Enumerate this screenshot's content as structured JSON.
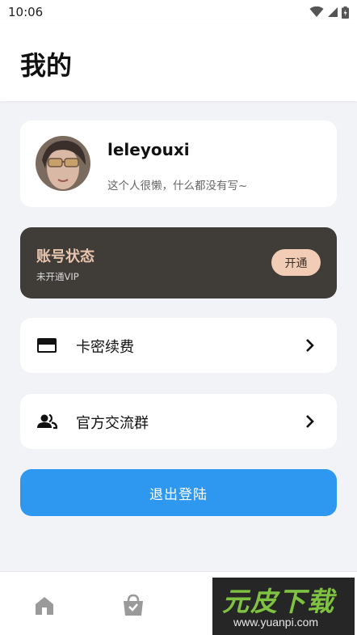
{
  "status_bar": {
    "time": "10:06",
    "icons": [
      "wifi-icon",
      "signal-icon",
      "battery-charging-icon"
    ]
  },
  "header": {
    "title": "我的"
  },
  "profile": {
    "username": "leleyouxi",
    "bio": "这个人很懒，什么都没有写~"
  },
  "account": {
    "title": "账号状态",
    "status": "未开通VIP",
    "button": "开通"
  },
  "menu": [
    {
      "label": "卡密续费",
      "icon": "credit-card-icon"
    },
    {
      "label": "官方交流群",
      "icon": "group-icon"
    }
  ],
  "logout": {
    "label": "退出登陆"
  },
  "bottom_nav": [
    {
      "icon": "home-icon"
    },
    {
      "icon": "shopping-bag-icon"
    }
  ],
  "watermark": {
    "brand": "元皮下载",
    "url": "www.yuanpi.com"
  },
  "colors": {
    "accent": "#2e98f0",
    "vip_card": "#403c38",
    "vip_text": "#e9c4ad",
    "vip_button": "#f2cdb6",
    "background": "#f2f3f7"
  }
}
